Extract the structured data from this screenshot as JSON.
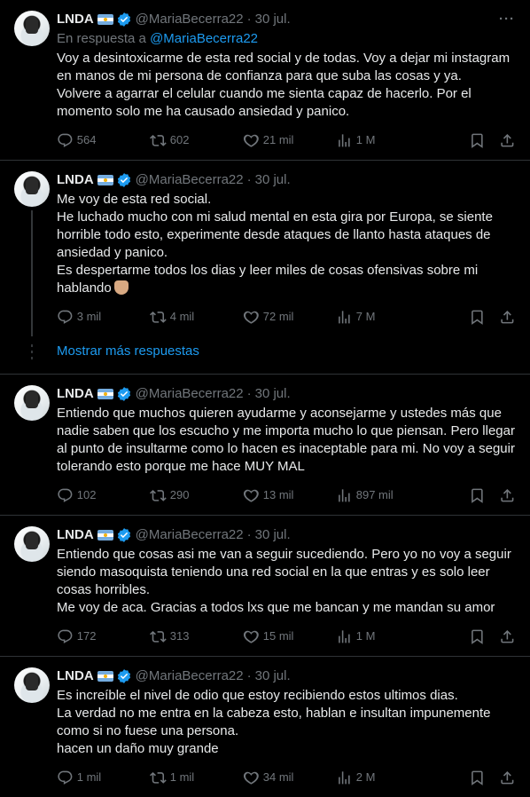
{
  "colors": {
    "background": "#000000",
    "text": "#e7e9ea",
    "muted": "#71767b",
    "link": "#1d9bf0",
    "border": "#2f3336"
  },
  "author": {
    "name": "LNDA",
    "handle": "@MariaBecerra22",
    "flag_icon": "argentina-flag-icon",
    "verified_icon": "verified-badge-icon"
  },
  "tweets": [
    {
      "date": "30 jul.",
      "reply_prefix": "En respuesta a",
      "reply_to": "@MariaBecerra22",
      "text": "Voy a desintoxicarme de esta red social y de todas. Voy a dejar mi instagram en manos de mi persona de confianza para que suba las cosas y ya.\nVolvere a agarrar el celular cuando me sienta capaz de hacerlo. Por el momento solo me ha causado ansiedad y panico.",
      "replies": "564",
      "retweets": "602",
      "likes": "21 mil",
      "views": "1 M"
    },
    {
      "date": "30 jul.",
      "text": "Me voy de esta red social.\nHe luchado mucho con mi salud mental en esta gira por Europa, se siente horrible todo esto, experimente desde ataques de llanto hasta ataques de ansiedad y panico.\nEs despertarme todos los dias y leer miles de cosas ofensivas sobre mi hablando",
      "emoji_icon": "pointing-down-emoji-icon",
      "replies": "3 mil",
      "retweets": "4 mil",
      "likes": "72 mil",
      "views": "7 M"
    },
    {
      "date": "30 jul.",
      "text": "Entiendo que muchos quieren ayudarme y aconsejarme y ustedes más que nadie saben que los escucho y me importa mucho lo que piensan. Pero llegar al punto de insultarme como lo hacen es inaceptable para mi. No voy a seguir tolerando esto porque me hace MUY MAL",
      "replies": "102",
      "retweets": "290",
      "likes": "13 mil",
      "views": "897 mil"
    },
    {
      "date": "30 jul.",
      "text": "Entiendo que cosas asi me van a seguir sucediendo. Pero yo no voy a seguir siendo masoquista teniendo una red social en la que entras y es solo leer cosas horribles.\nMe voy de aca. Gracias a todos lxs que me bancan y me mandan su amor",
      "replies": "172",
      "retweets": "313",
      "likes": "15 mil",
      "views": "1 M"
    },
    {
      "date": "30 jul.",
      "text": "Es increíble el nivel de odio que estoy recibiendo estos ultimos dias.\nLa verdad no me entra en la cabeza esto, hablan e insultan impunemente como si no fuese una persona.\nhacen un daño muy grande",
      "replies": "1 mil",
      "retweets": "1 mil",
      "likes": "34 mil",
      "views": "2 M"
    }
  ],
  "show_more_label": "Mostrar más respuestas",
  "icons": {
    "reply": "reply-icon",
    "retweet": "retweet-icon",
    "like": "heart-icon",
    "views": "views-chart-icon",
    "bookmark": "bookmark-icon",
    "share": "share-icon",
    "more": "more-icon"
  }
}
